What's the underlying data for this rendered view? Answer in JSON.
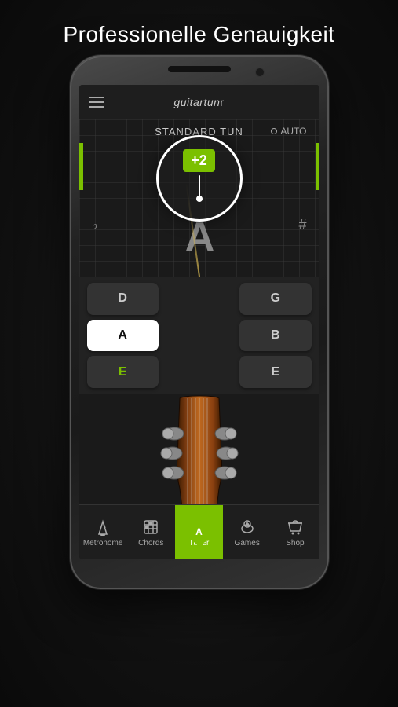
{
  "page": {
    "title": "Professionelle Genauigkeit"
  },
  "app": {
    "logo": "guitartun",
    "logo_suffix": "r"
  },
  "tuner": {
    "title": "STANDARD TUN",
    "auto_label": "AUTO",
    "cents": "+2",
    "main_note": "A",
    "flat_symbol": "♭",
    "sharp_symbol": "#"
  },
  "notes": [
    {
      "label": "D",
      "active": false,
      "col": 1
    },
    {
      "label": "",
      "active": false,
      "col": 2
    },
    {
      "label": "G",
      "active": false,
      "col": 3
    },
    {
      "label": "A",
      "active": true,
      "col": 1
    },
    {
      "label": "",
      "active": false,
      "col": 2
    },
    {
      "label": "B",
      "active": false,
      "col": 3
    },
    {
      "label": "E",
      "active": false,
      "col": 1
    },
    {
      "label": "",
      "active": false,
      "col": 2
    },
    {
      "label": "E",
      "active": false,
      "col": 3
    }
  ],
  "pin": {
    "label": "A"
  },
  "nav": {
    "items": [
      {
        "id": "metronome",
        "label": "Metronome",
        "active": false
      },
      {
        "id": "chords",
        "label": "Chords",
        "active": false
      },
      {
        "id": "tuner",
        "label": "Tuner",
        "active": true
      },
      {
        "id": "games",
        "label": "Games",
        "active": false
      },
      {
        "id": "shop",
        "label": "Shop",
        "active": false
      }
    ]
  }
}
